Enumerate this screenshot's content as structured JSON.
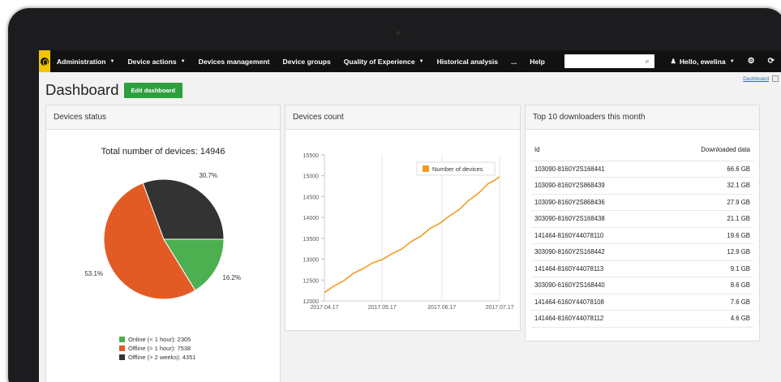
{
  "nav": {
    "items": [
      {
        "label": "Administration",
        "caret": true
      },
      {
        "label": "Device actions",
        "caret": true
      },
      {
        "label": "Devices management",
        "caret": false
      },
      {
        "label": "Device groups",
        "caret": false
      },
      {
        "label": "Quality of Experience",
        "caret": true
      },
      {
        "label": "Historical analysis",
        "caret": false
      },
      {
        "label": "...",
        "caret": false
      },
      {
        "label": "Help",
        "caret": false
      }
    ],
    "search_icon": "search-icon",
    "user_label": "Hello, ewelina",
    "brand_color": "#f2c500"
  },
  "page": {
    "title": "Dashboard",
    "edit_button": "Edit dashboard",
    "dashboard_link": "Dashboard"
  },
  "status_panel": {
    "header": "Devices status",
    "total_label": "Total number of devices: 14946"
  },
  "count_panel": {
    "header": "Devices count"
  },
  "top_panel": {
    "header": "Top 10 downloaders this month",
    "columns": [
      "Id",
      "Downloaded data"
    ],
    "rows": [
      {
        "id": "103090-8160Y2S168441",
        "data": "66.6 GB"
      },
      {
        "id": "103090-8160Y2S868439",
        "data": "32.1 GB"
      },
      {
        "id": "103090-8160Y2S868436",
        "data": "27.9 GB"
      },
      {
        "id": "303090-8160Y2S168438",
        "data": "21.1 GB"
      },
      {
        "id": "141464-8160Y44078110",
        "data": "19.6 GB"
      },
      {
        "id": "303090-8160Y2S168442",
        "data": "12.9 GB"
      },
      {
        "id": "141464-8160Y44078113",
        "data": "9.1 GB"
      },
      {
        "id": "303090-6160Y2S168440",
        "data": "8.6 GB"
      },
      {
        "id": "141464-6160Y44078108",
        "data": "7.6 GB"
      },
      {
        "id": "141464-8160Y44078112",
        "data": "4.6 GB"
      }
    ]
  },
  "chart_data": [
    {
      "type": "pie",
      "title": "Total number of devices: 14946",
      "slices": [
        {
          "label": "Online (< 1 hour): 2305",
          "value": 2305,
          "percent_label": "16.2%",
          "color": "#4caf50"
        },
        {
          "label": "Offline (> 1 hour): 7538",
          "value": 7538,
          "percent_label": "53.1%",
          "color": "#e35b24"
        },
        {
          "label": "Offline (> 2 weeks): 4351",
          "value": 4351,
          "percent_label": "30.7%",
          "color": "#333333"
        }
      ],
      "legend_position": "bottom"
    },
    {
      "type": "line",
      "title": "",
      "xlabel": "",
      "ylabel": "",
      "x_ticks": [
        "2017.04.17",
        "2017.05.17",
        "2017.06.17",
        "2017.07.17"
      ],
      "y_ticks": [
        12000,
        12500,
        13000,
        13500,
        14000,
        14500,
        15000,
        15500
      ],
      "ylim": [
        12000,
        15500
      ],
      "xlim": [
        0,
        91
      ],
      "grid": true,
      "legend_position": "top-right",
      "series": [
        {
          "name": "Number of devices",
          "color": "#f39c1f",
          "x": [
            0,
            5,
            10,
            15,
            20,
            25,
            30,
            35,
            40,
            45,
            50,
            55,
            60,
            65,
            70,
            75,
            80,
            85,
            88,
            91
          ],
          "y": [
            12200,
            12330,
            12480,
            12630,
            12770,
            12880,
            12990,
            13100,
            13240,
            13390,
            13550,
            13710,
            13860,
            14010,
            14190,
            14380,
            14580,
            14780,
            14880,
            14946
          ]
        }
      ]
    }
  ]
}
